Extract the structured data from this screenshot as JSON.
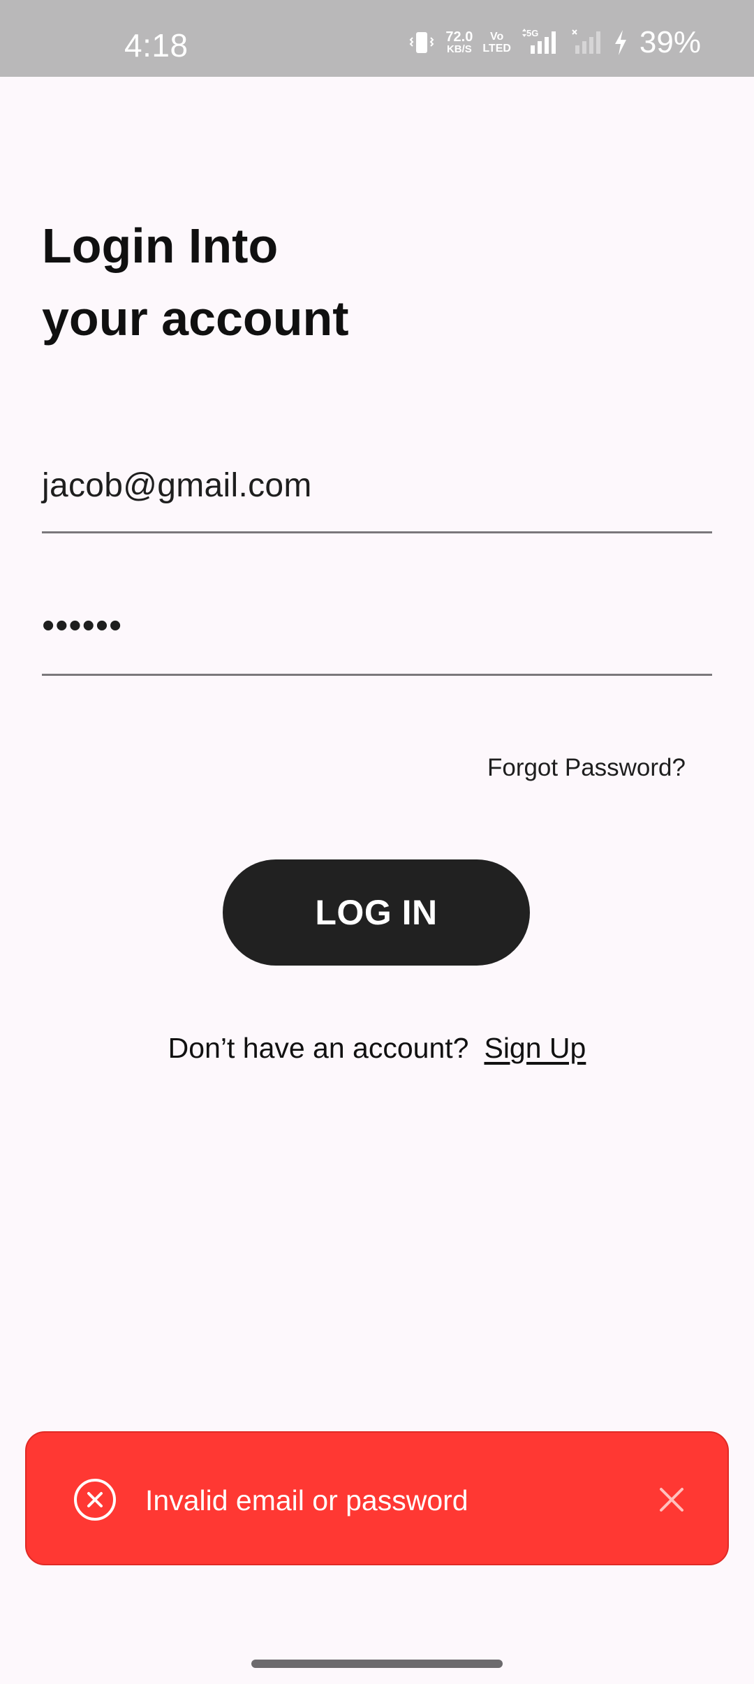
{
  "status_bar": {
    "time": "4:18",
    "net_speed_value": "72.0",
    "net_speed_unit": "KB/S",
    "volte_top": "Vo",
    "volte_bottom": "LTED",
    "network_type": "5G",
    "battery_percent": "39%",
    "icons": [
      "vibrate-icon",
      "signal-icon",
      "signal-x-icon",
      "charging-icon"
    ]
  },
  "heading": {
    "line1": "Login Into",
    "line2": "your account"
  },
  "form": {
    "email_value": "jacob@gmail.com",
    "password_masked": "••••••",
    "forgot_label": "Forgot Password?",
    "login_label": "LOG IN"
  },
  "signup": {
    "question": "Don’t have an account?",
    "link_label": "Sign Up"
  },
  "toast": {
    "message": "Invalid email or password",
    "color": "#ff3833"
  }
}
